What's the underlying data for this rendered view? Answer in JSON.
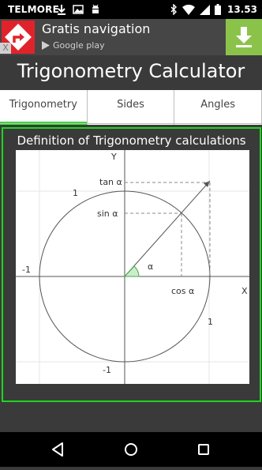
{
  "status_bar": {
    "carrier": "TELMORE",
    "time": "13.53",
    "left_icons": [
      "download-icon",
      "image-icon",
      "android-icon"
    ],
    "right_icons": [
      "bluetooth-icon",
      "wifi-icon",
      "signal-icon",
      "battery-icon"
    ]
  },
  "ad_banner": {
    "title": "Gratis navigation",
    "store": "Google play",
    "close_label": "X",
    "accent_color": "#8bc34a",
    "logo_color": "#e0232b"
  },
  "app": {
    "title": "Trigonometry Calculator"
  },
  "tabs": [
    {
      "label": "Trigonometry",
      "selected": true
    },
    {
      "label": "Sides",
      "selected": false
    },
    {
      "label": "Angles",
      "selected": false
    }
  ],
  "panel": {
    "title": "Definition of Trigonometry calculations",
    "border_color": "#1ed61e"
  },
  "diagram": {
    "axis_x_label": "X",
    "axis_y_label": "Y",
    "tan_label": "tan α",
    "sin_label": "sin α",
    "cos_label": "cos α",
    "angle_label": "α",
    "label_y_pos": "1",
    "label_y_neg": "-1",
    "label_x_pos": "1",
    "label_x_neg": "-1"
  },
  "nav_bar": {
    "icons": [
      "back-icon",
      "home-icon",
      "recents-icon"
    ]
  }
}
